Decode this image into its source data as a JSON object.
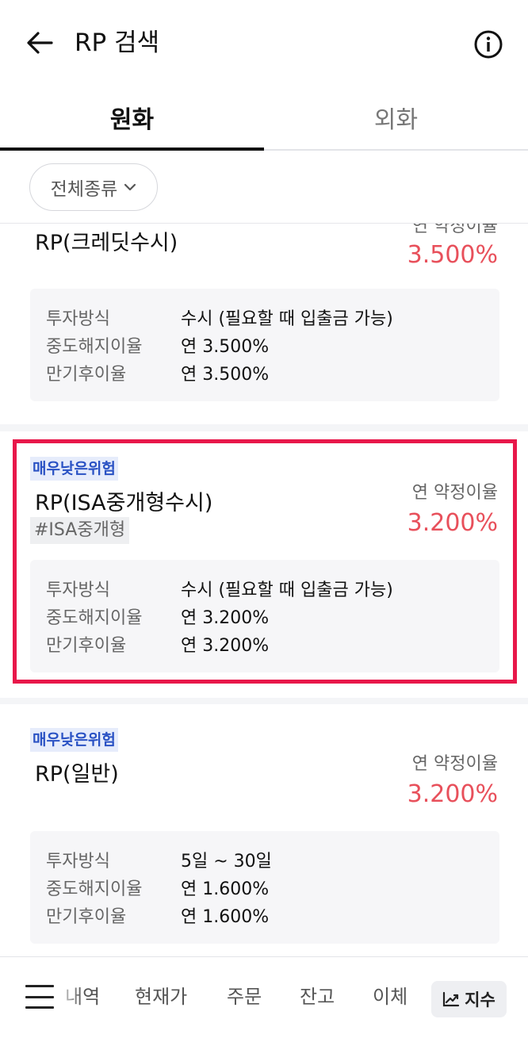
{
  "header": {
    "title": "RP 검색"
  },
  "tabs": [
    {
      "label": "원화"
    },
    {
      "label": "외화"
    }
  ],
  "filter": {
    "label": "전체종류"
  },
  "products": [
    {
      "risk": "",
      "name": "RP(크레딧수시)",
      "tag": "",
      "rate_label": "연 약정이율",
      "rate": "3.500%",
      "details": [
        {
          "key": "투자방식",
          "value": "수시 (필요할 때 입출금 가능)"
        },
        {
          "key": "중도해지이율",
          "value": "연 3.500%"
        },
        {
          "key": "만기후이율",
          "value": "연 3.500%"
        }
      ]
    },
    {
      "risk": "매우낮은위험",
      "name": "RP(ISA중개형수시)",
      "tag": "#ISA중개형",
      "rate_label": "연 약정이율",
      "rate": "3.200%",
      "details": [
        {
          "key": "투자방식",
          "value": "수시 (필요할 때 입출금 가능)"
        },
        {
          "key": "중도해지이율",
          "value": "연 3.200%"
        },
        {
          "key": "만기후이율",
          "value": "연 3.200%"
        }
      ]
    },
    {
      "risk": "매우낮은위험",
      "name": "RP(일반)",
      "tag": "",
      "rate_label": "연 약정이율",
      "rate": "3.200%",
      "details": [
        {
          "key": "투자방식",
          "value": "5일 ~ 30일"
        },
        {
          "key": "중도해지이율",
          "value": "연 1.600%"
        },
        {
          "key": "만기후이율",
          "value": "연 1.600%"
        }
      ]
    }
  ],
  "bottom_nav": {
    "items": [
      "내역",
      "현재가",
      "주문",
      "잔고",
      "이체"
    ],
    "index_label": "지수"
  },
  "colors": {
    "rate": "#e8505b",
    "risk_badge_text": "#2a52c4",
    "highlight": "#e8174a"
  }
}
